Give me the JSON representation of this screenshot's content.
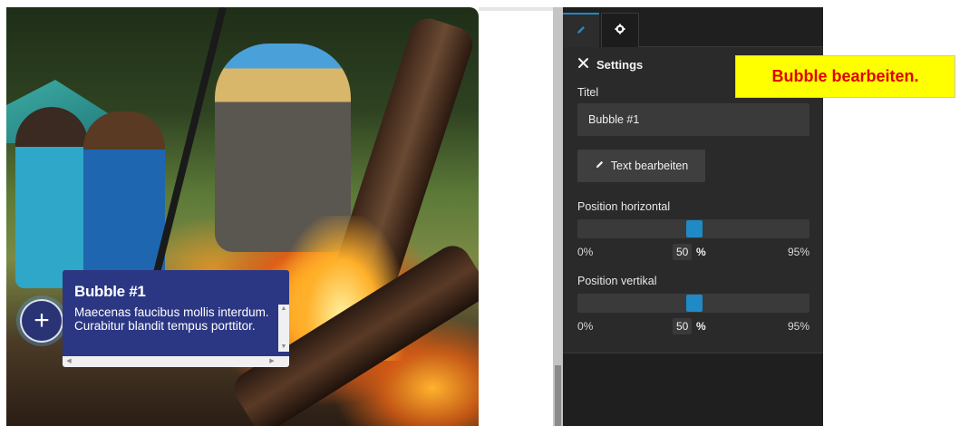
{
  "bubble": {
    "title": "Bubble #1",
    "text": "Maecenas faucibus mollis interdum. Curabitur blandit tempus porttitor.",
    "add_symbol": "+"
  },
  "panel": {
    "tabs": [
      {
        "icon": "pencil-icon",
        "active": true
      },
      {
        "icon": "gear-icon",
        "active": false
      }
    ],
    "section_title": "Settings",
    "title_label": "Titel",
    "title_value": "Bubble #1",
    "edit_text_label": "Text bearbeiten",
    "horizontal": {
      "label": "Position horizontal",
      "min": "0%",
      "value": "50",
      "unit": "%",
      "max": "95%",
      "fraction": 0.5
    },
    "vertical": {
      "label": "Position vertikal",
      "min": "0%",
      "value": "50",
      "unit": "%",
      "max": "95%",
      "fraction": 0.5
    }
  },
  "callout": {
    "text": "Bubble bearbeiten."
  },
  "colors": {
    "accent": "#1f8ac5",
    "bubble_bg": "#2b3783",
    "panel_bg": "#2a2a2a",
    "callout_bg": "#ffff00",
    "callout_text": "#e00000"
  }
}
